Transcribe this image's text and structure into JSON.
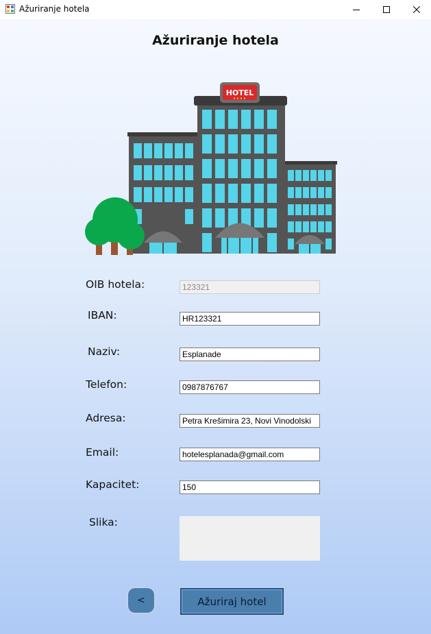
{
  "window": {
    "title": "Ažuriranje hotela",
    "controls": [
      "minimize-icon",
      "maximize-icon",
      "close-icon"
    ]
  },
  "page": {
    "title": "Ažuriranje hotela"
  },
  "illustration": {
    "icon": "hotel-building-illustration",
    "sign_text": "HOTEL"
  },
  "form": {
    "oib": {
      "label": "OIB hotela:",
      "value": "123321",
      "disabled": true
    },
    "iban": {
      "label": "IBAN:",
      "value": "HR123321"
    },
    "naziv": {
      "label": "Naziv:",
      "value": "Esplanade"
    },
    "telefon": {
      "label": "Telefon:",
      "value": "0987876767"
    },
    "adresa": {
      "label": "Adresa:",
      "value": "Petra Krešimira 23, Novi Vinodolski"
    },
    "email": {
      "label": "Email:",
      "value": "hotelesplanada@gmail.com"
    },
    "kapacitet": {
      "label": "Kapacitet:",
      "value": "150"
    },
    "slika": {
      "label": "Slika:"
    }
  },
  "buttons": {
    "back_label": "<",
    "update_label": "Ažuriraj hotel"
  },
  "colors": {
    "button_bg": "#4a7ead",
    "window_bg_top": "#f7faff",
    "window_bg_bottom": "#aecaf5",
    "building_wall": "#545454",
    "window_glass": "#55d4ea",
    "sign_red": "#d82a2a",
    "tree_green": "#0aa84a"
  }
}
